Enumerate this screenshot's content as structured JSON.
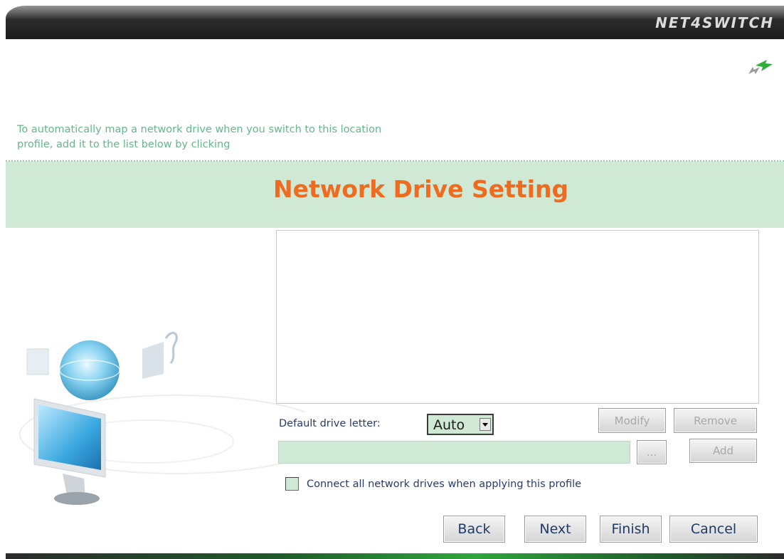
{
  "header": {
    "brand": "NET4SWITCH"
  },
  "intro": {
    "text_line1": "To automatically map a network drive when you switch to this location",
    "text_line2": "profile, add it to the list below by clicking"
  },
  "section": {
    "title": "Network Drive Setting"
  },
  "drive_list": {
    "items": []
  },
  "drive_letter": {
    "label": "Default drive letter:",
    "selected": "Auto"
  },
  "list_actions": {
    "modify_label": "Modify",
    "remove_label": "Remove",
    "browse_label": "...",
    "add_label": "Add"
  },
  "path_input": {
    "value": ""
  },
  "connect_option": {
    "label": "Connect all network drives when applying this profile",
    "checked": false
  },
  "wizard_nav": {
    "back_label": "Back",
    "next_label": "Next",
    "finish_label": "Finish",
    "cancel_label": "Cancel"
  },
  "colors": {
    "accent_orange": "#ee6b1f",
    "band_green": "#cfe9d4",
    "hint_green": "#66b68a",
    "label_blue": "#2a3b6b"
  },
  "icons": {
    "sync": "sync-arrows-icon",
    "illustration": "monitor-globe-illustration"
  }
}
